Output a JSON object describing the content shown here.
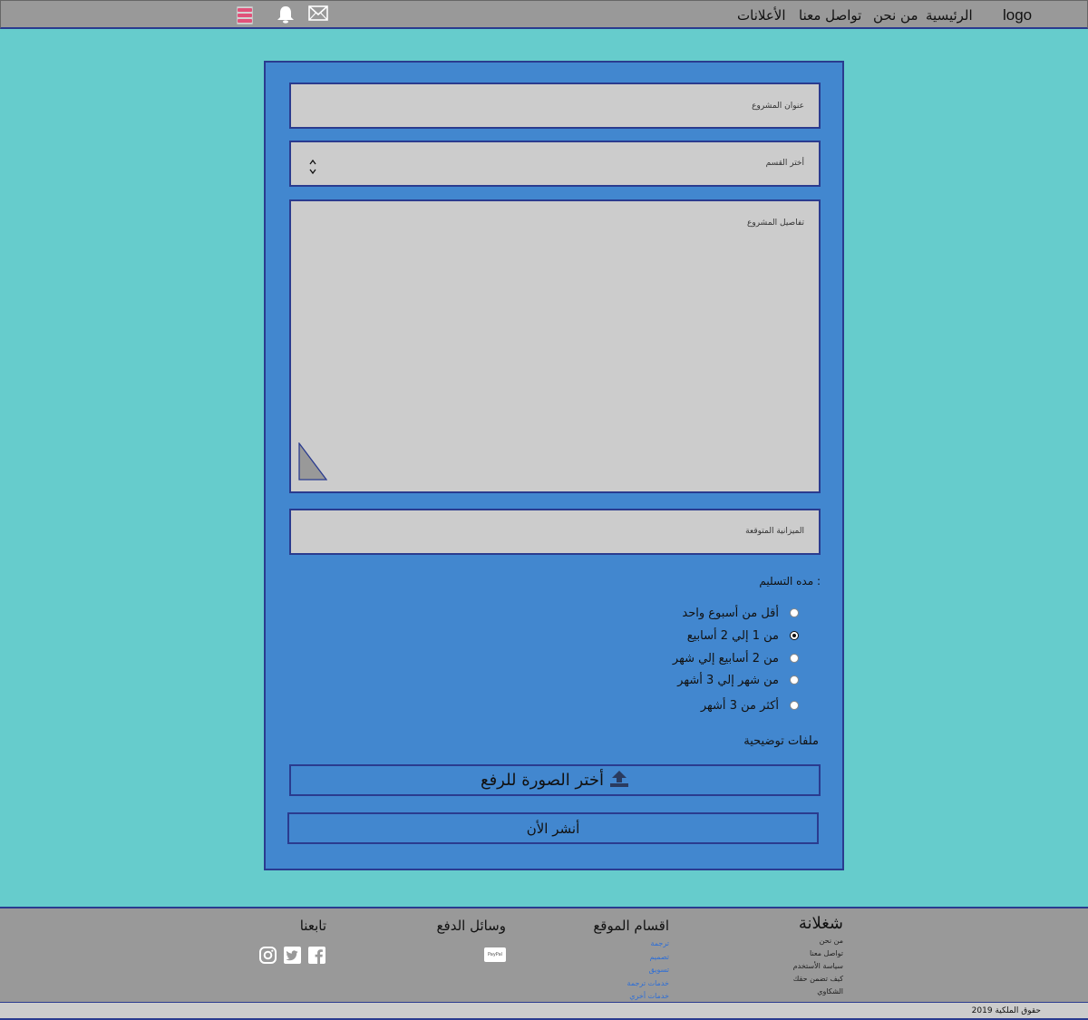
{
  "header": {
    "logo": "logo",
    "nav": [
      "الرئيسية",
      "من نحن",
      "تواصل معنا",
      "الأعلانات"
    ],
    "menu_color": "#e0527a"
  },
  "form": {
    "title_placeholder": "عنوان المشروع",
    "category_placeholder": "أختر القسم",
    "details_placeholder": "تفاصيل المشروع",
    "budget_placeholder": "الميزانية المتوقعة",
    "delivery_label": "مده التسليم :",
    "delivery_options": [
      {
        "label": "أقل من أسبوع واحد",
        "checked": false
      },
      {
        "label": "من 1 إلي 2 أسابيع",
        "checked": true
      },
      {
        "label": "من 2 أسابيع إلي شهر",
        "checked": false
      },
      {
        "label": "من شهر إلي 3 أشهر",
        "checked": false
      },
      {
        "label": "أكثر من 3 أشهر",
        "checked": false
      }
    ],
    "files_label": "ملفات توضيحية",
    "upload_label": "أختر الصورة للرفع",
    "publish_label": "أنشر الأن"
  },
  "footer": {
    "brand": "شغلانة",
    "brand_links": [
      "من نحن",
      "تواصل معنا",
      "سياسة الأستخدم",
      "كيف تضمن حقك",
      "الشكاوي"
    ],
    "sections_title": "اقسام الموقع",
    "sections": [
      "ترجمة",
      "تصميم",
      "تسويق",
      "خدمات ترجمة",
      "خدمات أخري"
    ],
    "payment_title": "وسائل الدفع",
    "payment_paypal": "PayPal",
    "follow_title": "تابعنا",
    "copyright": "حقوق الملكية 2019"
  }
}
